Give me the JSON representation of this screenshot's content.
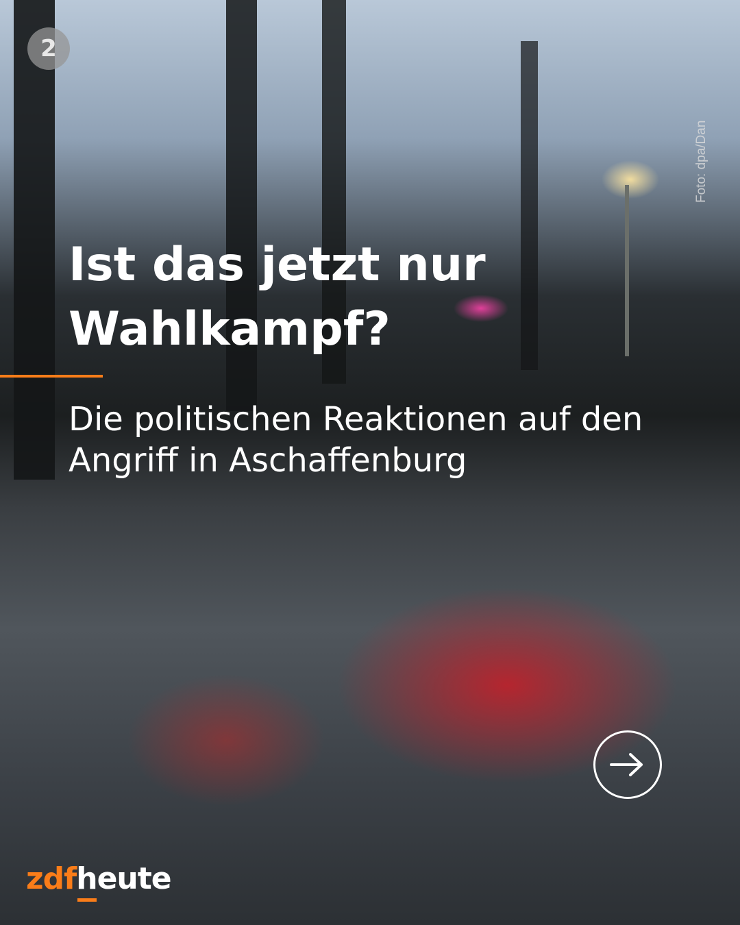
{
  "post": {
    "headline": "Ist das jetzt nur Wahlkampf?",
    "subheadline": "Die politischen Reaktionen auf den Angriff in Aschaffenburg",
    "photo_credit": "Foto: dpa/Dan",
    "top_logo": "2",
    "brand_prefix": "zdf",
    "brand_suffix": "heute",
    "next_icon": "arrow-right-circle-icon"
  },
  "colors": {
    "accent": "#fa7d19",
    "text": "#ffffff"
  }
}
